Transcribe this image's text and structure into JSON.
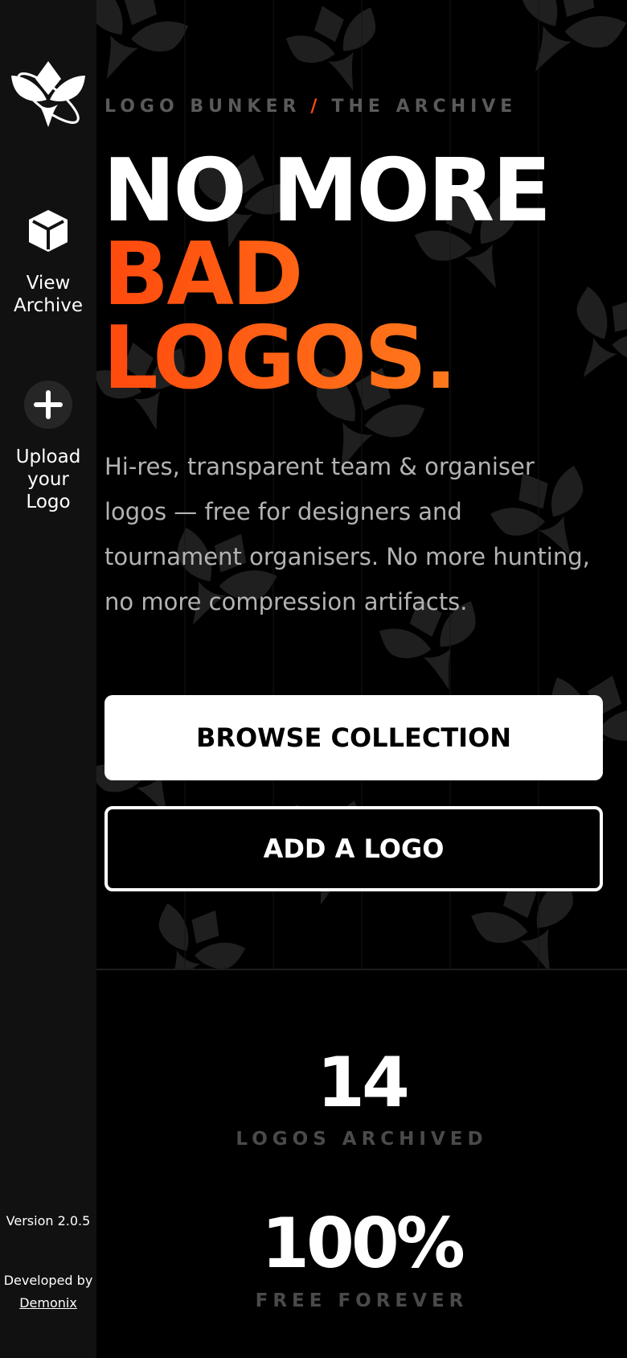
{
  "sidebar": {
    "logo_icon": "logo-bunker-emblem-icon",
    "items": [
      {
        "icon": "box-icon",
        "label_line1": "View",
        "label_line2": "Archive"
      },
      {
        "icon": "plus-icon",
        "label_line1": "Upload",
        "label_line2": "your",
        "label_line3": "Logo"
      }
    ],
    "version": "Version 2.0.5",
    "developed_by": "Developed by",
    "developer": "Demonix"
  },
  "hero": {
    "eyebrow_left": "LOGO BUNKER",
    "eyebrow_sep": "/",
    "eyebrow_right": "THE ARCHIVE",
    "headline_1": "NO MORE",
    "headline_2": "BAD",
    "headline_3": "LOGOS.",
    "lead": "Hi-res, transparent team & organiser logos — free for designers and tournament organisers. No more hunting, no more compression artifacts.",
    "primary_button": "BROWSE COLLECTION",
    "secondary_button": "ADD A LOGO"
  },
  "stats": [
    {
      "value": "14",
      "label": "LOGOS ARCHIVED"
    },
    {
      "value": "100%",
      "label": "FREE FOREVER"
    }
  ],
  "colors": {
    "accent": "#ff5a14",
    "background": "#000000",
    "sidebar": "#111111"
  }
}
